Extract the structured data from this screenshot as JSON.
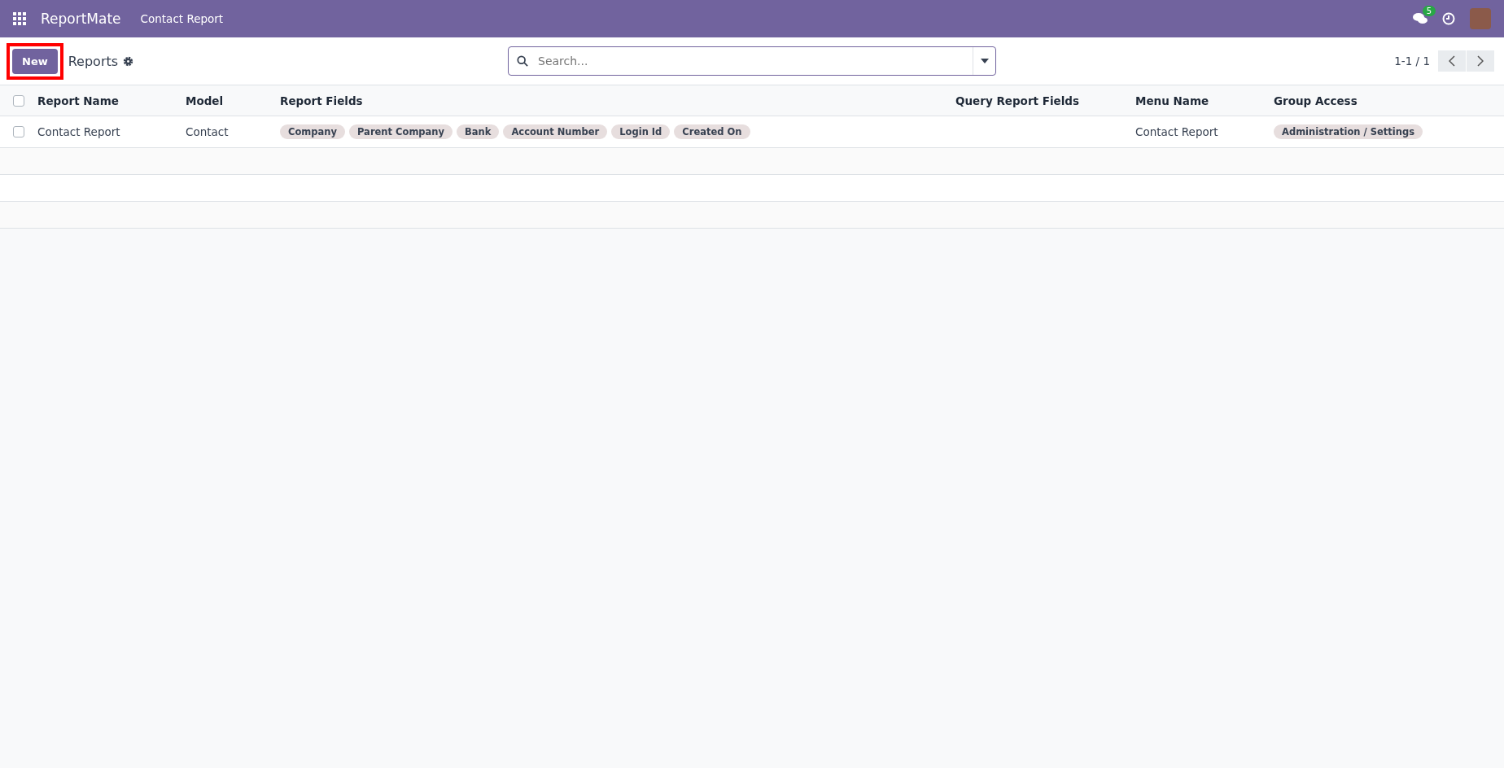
{
  "navbar": {
    "app_name": "ReportMate",
    "menu": "Contact Report",
    "chat_count": "5"
  },
  "control_panel": {
    "new_button": "New",
    "highlighted": true,
    "title": "Reports",
    "search": {
      "placeholder": "Search..."
    },
    "pager": "1-1 / 1"
  },
  "table": {
    "columns": [
      "Report Name",
      "Model",
      "Report Fields",
      "Query Report Fields",
      "Menu Name",
      "Group Access"
    ],
    "all_checked": false,
    "rows": [
      {
        "checked": false,
        "report_name": "Contact Report",
        "model": "Contact",
        "report_fields": [
          "Company",
          "Parent Company",
          "Bank",
          "Account Number",
          "Login Id",
          "Created On"
        ],
        "query_report_fields": [],
        "menu_name": "Contact Report",
        "group_access": [
          "Administration / Settings"
        ]
      }
    ]
  }
}
